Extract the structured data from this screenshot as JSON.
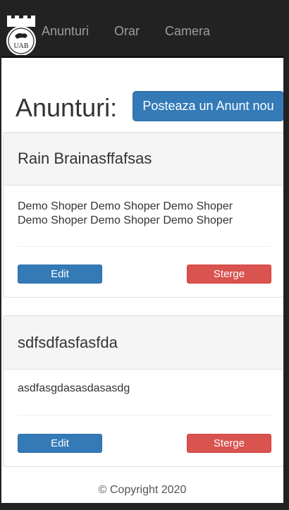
{
  "navbar": {
    "logo_text": "UAB",
    "links": [
      "Anunturi",
      "Orar",
      "Camera"
    ]
  },
  "page": {
    "heading": "Anunturi:",
    "post_button": "Posteaza un Anunt nou"
  },
  "announcements": [
    {
      "title": "Rain Brainasffafsas",
      "body": "Demo Shoper Demo Shoper Demo Shoper Demo Shoper Demo Shoper Demo Shoper",
      "edit_label": "Edit",
      "delete_label": "Sterge"
    },
    {
      "title": "sdfsdfasfasfda",
      "body": "asdfasgdasasdasasdg",
      "edit_label": "Edit",
      "delete_label": "Sterge"
    }
  ],
  "footer": {
    "text": "© Copyright 2020"
  },
  "colors": {
    "navbar_bg": "#222222",
    "primary": "#337ab7",
    "danger": "#d9534f",
    "panel_heading_bg": "#f5f5f5"
  }
}
